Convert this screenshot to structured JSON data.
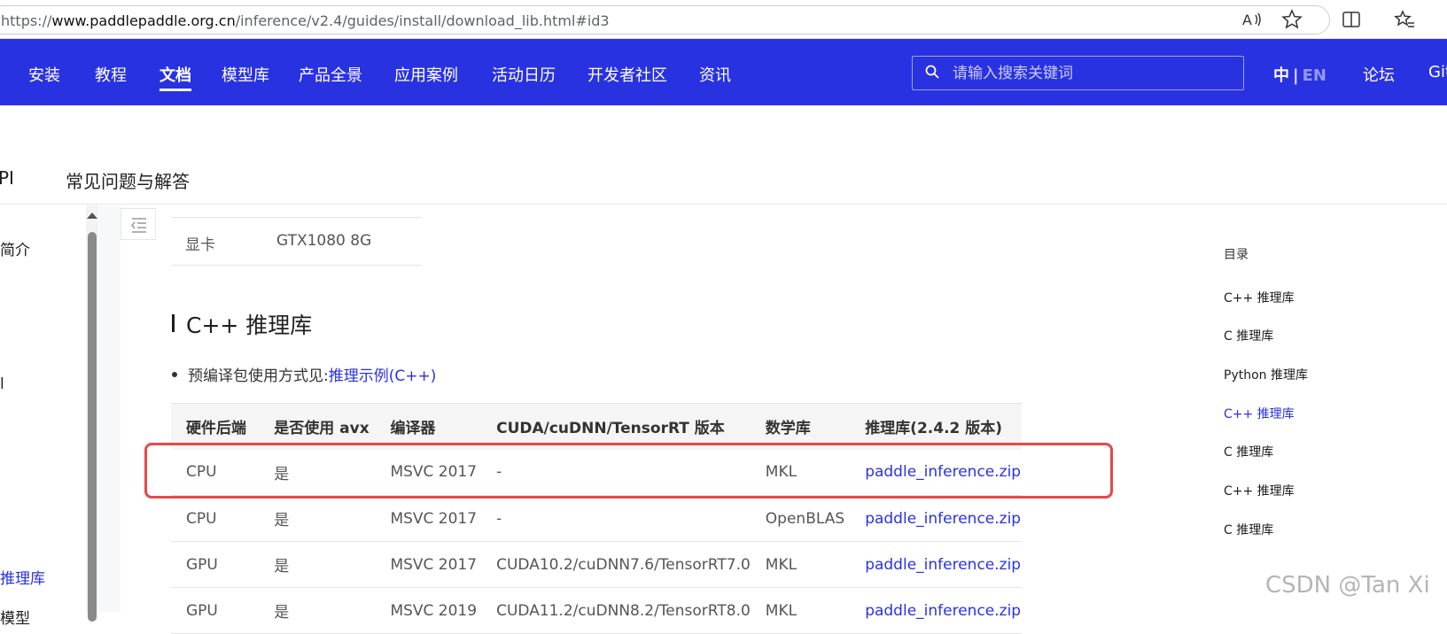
{
  "browser": {
    "url_prefix": "https://",
    "url_domain": "www.paddlepaddle.org.cn",
    "url_path": "/inference/v2.4/guides/install/download_lib.html#id3"
  },
  "topnav": {
    "items": [
      "安装",
      "教程",
      "文档",
      "模型库",
      "产品全景",
      "应用案例",
      "活动日历",
      "开发者社区",
      "资讯"
    ],
    "active_item": "文档",
    "search_placeholder": "请输入搜索关键词",
    "lang_zh": "中",
    "lang_sep": "|",
    "lang_en": "EN",
    "forum": "论坛",
    "github_partial": "Git"
  },
  "subnav": {
    "api_partial": "PI",
    "faq": "常见问题与解答"
  },
  "sidebar": {
    "item_intro_partial": "简介",
    "item_mid_partial": "l",
    "item_lib_partial": "推理库",
    "item_bottom_partial": "模型"
  },
  "main": {
    "spec_label": "显卡",
    "spec_value": "GTX1080 8G",
    "section_title": "C++ 推理库",
    "bullet_text": "预编译包使用方式见:",
    "bullet_link": "推理示例(C++)",
    "table": {
      "headers": [
        "硬件后端",
        "是否使用 avx",
        "编译器",
        "CUDA/cuDNN/TensorRT 版本",
        "数学库",
        "推理库(2.4.2 版本)"
      ],
      "rows": [
        [
          "CPU",
          "是",
          "MSVC 2017",
          "-",
          "MKL",
          "paddle_inference.zip"
        ],
        [
          "CPU",
          "是",
          "MSVC 2017",
          "-",
          "OpenBLAS",
          "paddle_inference.zip"
        ],
        [
          "GPU",
          "是",
          "MSVC 2017",
          "CUDA10.2/cuDNN7.6/TensorRT7.0",
          "MKL",
          "paddle_inference.zip"
        ],
        [
          "GPU",
          "是",
          "MSVC 2019",
          "CUDA11.2/cuDNN8.2/TensorRT8.0",
          "MKL",
          "paddle_inference.zip"
        ]
      ]
    }
  },
  "toc": {
    "title": "目录",
    "items": [
      "C++ 推理库",
      "C 推理库",
      "Python 推理库",
      "C++ 推理库",
      "C 推理库",
      "C++ 推理库",
      "C 推理库"
    ],
    "active_index": 3
  },
  "watermark": "CSDN @Tan Xi",
  "colors": {
    "brand_blue": "#2932e1",
    "highlight_red": "#e8474b",
    "link_blue": "#2932e1"
  }
}
